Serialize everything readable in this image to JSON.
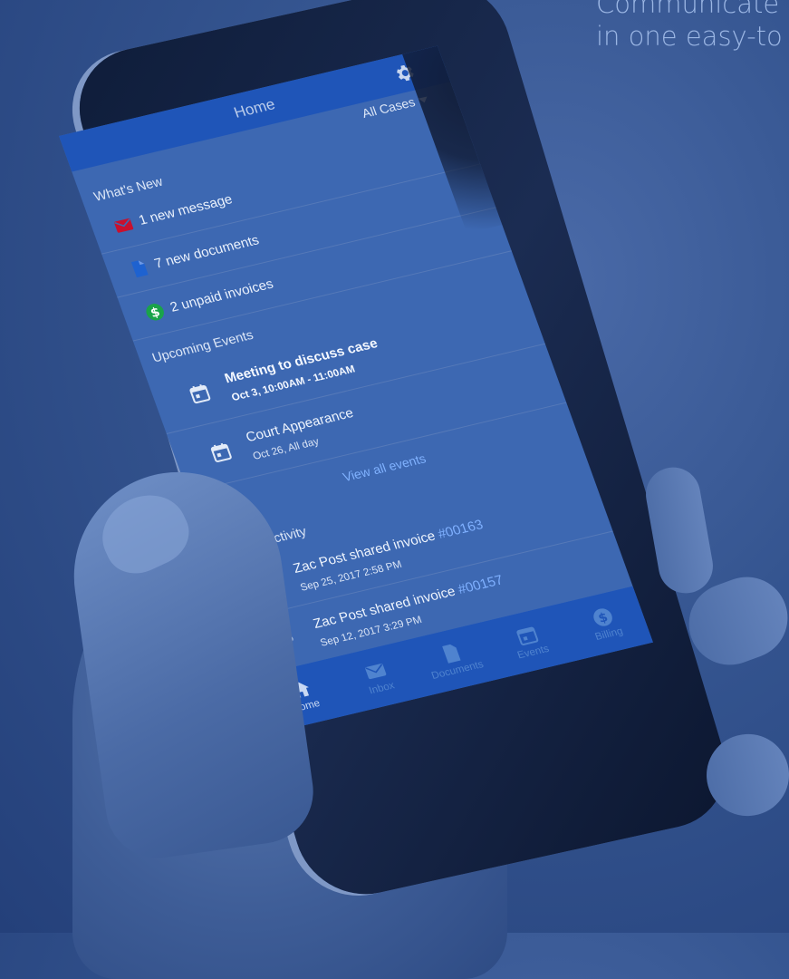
{
  "tagline": {
    "line1": "Communicate",
    "line2": "in one easy-to"
  },
  "header": {
    "title": "Home"
  },
  "filter": {
    "label": "All Cases"
  },
  "whats_new": {
    "title": "What's New",
    "items": [
      {
        "label": "1 new message",
        "icon": "envelope-icon",
        "color": "#c8102e"
      },
      {
        "label": "7 new documents",
        "icon": "document-icon",
        "color": "#1e62d0"
      },
      {
        "label": "2 unpaid invoices",
        "icon": "dollar-circle-icon",
        "color": "#1aa34a"
      }
    ]
  },
  "events": {
    "title": "Upcoming Events",
    "items": [
      {
        "name": "Meeting to discuss case",
        "when": "Oct 3, 10:00AM - 11:00AM",
        "bold": true
      },
      {
        "name": "Court Appearance",
        "when": "Oct 26, All day",
        "bold": false
      }
    ],
    "view_all": "View all events"
  },
  "activity": {
    "title": "Recent Activity",
    "items": [
      {
        "text": "Zac Post shared invoice ",
        "number": "#00163",
        "when": "Sep 25, 2017 2:58 PM"
      },
      {
        "text": "Zac Post shared invoice ",
        "number": "#00157",
        "when": "Sep 12, 2017 3:29 PM"
      }
    ]
  },
  "tabs": [
    {
      "label": "Home",
      "icon": "home-icon",
      "active": true
    },
    {
      "label": "Inbox",
      "icon": "inbox-icon",
      "active": false
    },
    {
      "label": "Documents",
      "icon": "document-icon",
      "active": false
    },
    {
      "label": "Events",
      "icon": "calendar-icon",
      "active": false
    },
    {
      "label": "Billing",
      "icon": "dollar-circle-icon",
      "active": false
    }
  ],
  "colors": {
    "accent": "#1f55b8",
    "link": "#80b2ff"
  }
}
